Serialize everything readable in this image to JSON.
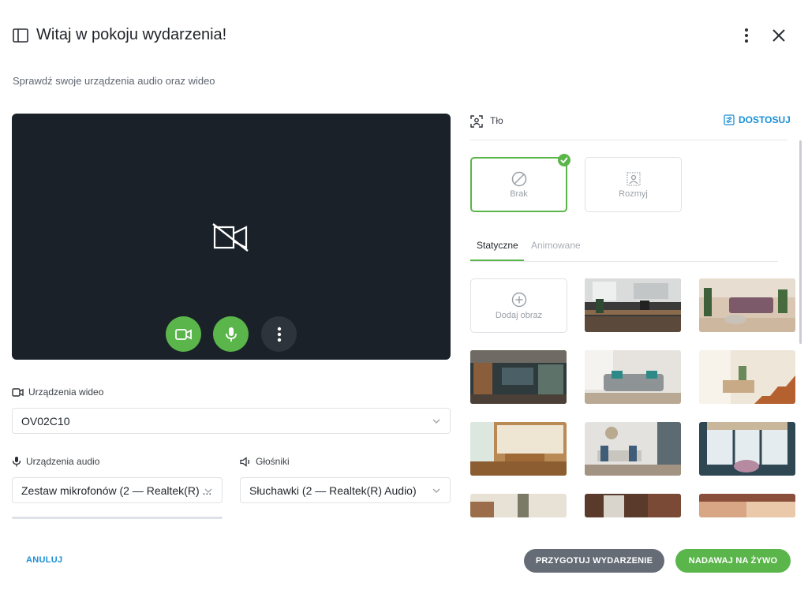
{
  "header": {
    "title": "Witaj w pokoju wydarzenia!",
    "subtitle": "Sprawdź swoje urządzenia audio oraz wideo"
  },
  "video_section": {
    "label": "Urządzenia wideo",
    "selected": "OV02C10"
  },
  "audio_section": {
    "label": "Urządzenia audio",
    "selected": "Zestaw mikrofonów (2 — Realtek(R) ..."
  },
  "speakers_section": {
    "label": "Głośniki",
    "selected": "Słuchawki (2 — Realtek(R) Audio)"
  },
  "background": {
    "label": "Tło",
    "adjust_label": "DOSTOSUJ",
    "options": [
      {
        "label": "Brak",
        "selected": true
      },
      {
        "label": "Rozmyj",
        "selected": false
      }
    ],
    "tabs": [
      {
        "label": "Statyczne",
        "active": true
      },
      {
        "label": "Animowane",
        "active": false
      }
    ],
    "add_image_label": "Dodaj obraz"
  },
  "footer": {
    "cancel_label": "ANULUJ",
    "prepare_label": "PRZYGOTUJ WYDARZENIE",
    "live_label": "NADAWAJ NA ŻYWO"
  },
  "colors": {
    "accent_green": "#5ab54a",
    "link_blue": "#1a8fd6",
    "preview_bg": "#1a2128",
    "prepare_button": "#656c76"
  }
}
